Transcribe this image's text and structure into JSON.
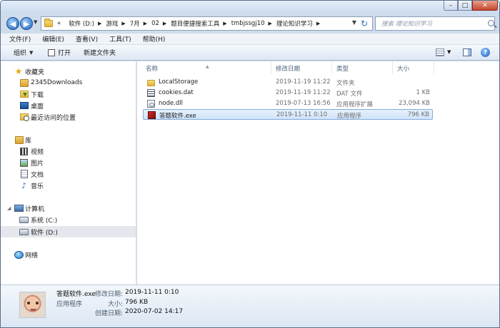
{
  "caption": {
    "minimize": "–",
    "maximize": "□",
    "close": "✕"
  },
  "nav": {
    "back": "◀",
    "forward": "▶"
  },
  "address": {
    "chevron": "«",
    "crumbs": [
      "软件 (D:)",
      "游戏",
      "7月",
      "02",
      "题目便捷搜索工具",
      "tmbjssgj10",
      "理论知识学习"
    ]
  },
  "search": {
    "placeholder": "搜索 理论知识学习"
  },
  "menu": [
    "文件(F)",
    "编辑(E)",
    "查看(V)",
    "工具(T)",
    "帮助(H)"
  ],
  "toolbar": {
    "organize": "组织",
    "open": "打开",
    "new_folder": "新建文件夹",
    "help": "?"
  },
  "sidebar": {
    "favorites": {
      "label": "收藏夹",
      "items": [
        "2345Downloads",
        "下载",
        "桌面",
        "最近访问的位置"
      ]
    },
    "libraries": {
      "label": "库",
      "items": [
        "视频",
        "图片",
        "文档",
        "音乐"
      ]
    },
    "computer": {
      "label": "计算机",
      "items": [
        "系统 (C:)",
        "软件 (D:)"
      ]
    },
    "network": {
      "label": "网络"
    }
  },
  "columns": {
    "name": "名称",
    "date": "修改日期",
    "type": "类型",
    "size": "大小"
  },
  "files": [
    {
      "name": "LocalStorage",
      "date": "2019-11-19 11:22",
      "type": "文件夹",
      "size": ""
    },
    {
      "name": "cookies.dat",
      "date": "2019-11-19 11:22",
      "type": "DAT 文件",
      "size": "1 KB"
    },
    {
      "name": "node.dll",
      "date": "2019-07-13 16:56",
      "type": "应用程序扩展",
      "size": "23,094 KB"
    },
    {
      "name": "答题软件.exe",
      "date": "2019-11-11 0:10",
      "type": "应用程序",
      "size": "796 KB"
    }
  ],
  "details": {
    "name": "答题软件.exe",
    "type": "应用程序",
    "modified_label": "修改日期:",
    "modified": "2019-11-11 0:10",
    "size_label": "大小:",
    "size": "796 KB",
    "created_label": "创建日期:",
    "created": "2020-07-02 14:17"
  }
}
